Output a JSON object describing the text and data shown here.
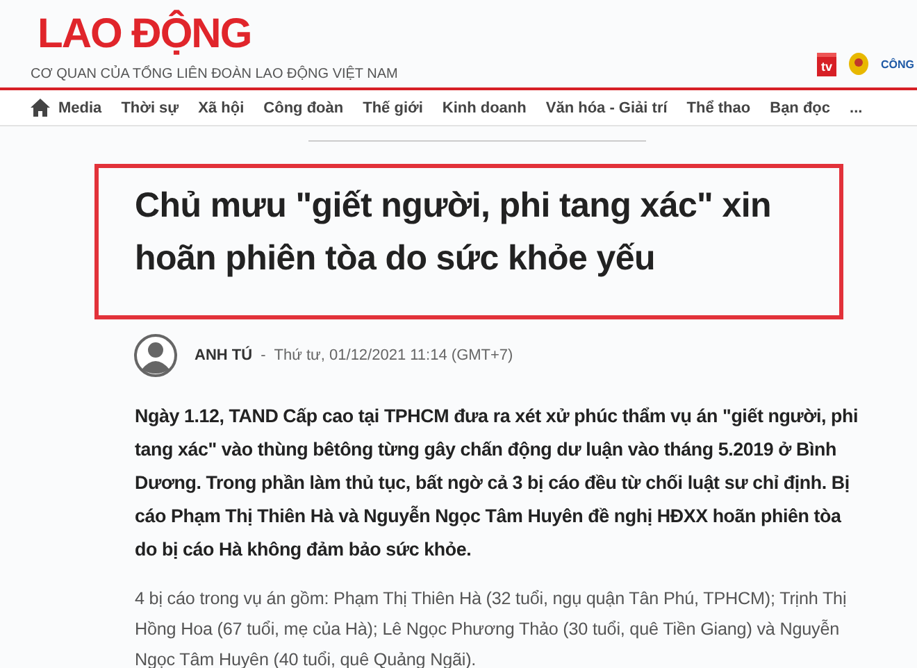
{
  "header": {
    "logo": "LAO ĐỘNG",
    "tagline": "CƠ QUAN CỦA TỔNG LIÊN ĐOÀN LAO ĐỘNG VIỆT NAM",
    "tv_label": "tv",
    "union_label": "CÔNG"
  },
  "nav": {
    "items": [
      "Media",
      "Thời sự",
      "Xã hội",
      "Công đoàn",
      "Thế giới",
      "Kinh doanh",
      "Văn hóa - Giải trí",
      "Thể thao",
      "Bạn đọc",
      "..."
    ]
  },
  "article": {
    "headline": "Chủ mưu \"giết người, phi tang xác\" xin hoãn phiên tòa do sức khỏe yếu",
    "author": "ANH TÚ",
    "separator": "-",
    "date": "Thứ tư, 01/12/2021 11:14 (GMT+7)",
    "lead": "Ngày 1.12, TAND Cấp cao tại TPHCM đưa ra xét xử phúc thẩm vụ án  \"giết người, phi tang xác\" vào thùng bêtông từng gây chấn động dư luận vào tháng 5.2019 ở Bình Dương. Trong phần làm thủ tục, bất ngờ cả 3 bị cáo đều từ chối luật sư chỉ định. Bị cáo Phạm Thị Thiên Hà và Nguyễn Ngọc Tâm Huyên đề nghị HĐXX hoãn phiên tòa do bị cáo Hà không đảm bảo sức khỏe.",
    "body": "4 bị cáo trong vụ án gồm: Phạm Thị Thiên Hà (32 tuổi, ngụ quận Tân Phú, TPHCM); Trịnh Thị Hồng Hoa (67 tuổi, mẹ của Hà); Lê Ngọc Phương Thảo (30 tuổi, quê Tiền Giang) và Nguyễn Ngọc Tâm Huyên (40 tuổi, quê Quảng Ngãi)."
  }
}
